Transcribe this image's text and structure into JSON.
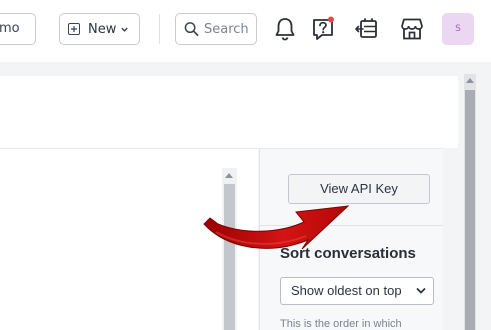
{
  "topbar": {
    "demo_button_label": "mo",
    "new_button_label": "New",
    "search_placeholder": "Search",
    "avatar_initial": "S",
    "icons": [
      "plus-square-icon",
      "chevron-down-icon",
      "search-icon",
      "bell-icon",
      "help-question-icon",
      "transfer-icon",
      "store-icon"
    ],
    "notification_dot_color": "#e5484d",
    "avatar_bg_color": "#ecd7f2"
  },
  "side_panel": {
    "api_button_label": "View API Key",
    "sort_title": "Sort conversations",
    "sort_selected": "Show oldest on top",
    "help_text": "This is the order in which"
  },
  "annotation": {
    "arrow_color": "#c00d0d",
    "arrow_icon": "curved-arrow-pointer"
  }
}
